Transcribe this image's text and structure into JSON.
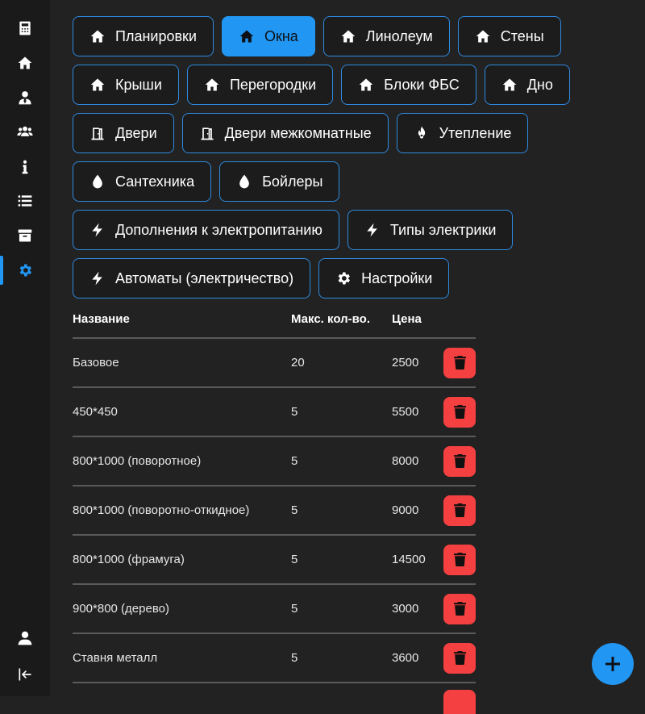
{
  "sidebar": {
    "items": [
      {
        "name": "calculator-icon"
      },
      {
        "name": "home-icon"
      },
      {
        "name": "user-tie-icon"
      },
      {
        "name": "users-icon"
      },
      {
        "name": "info-icon"
      },
      {
        "name": "list-icon"
      },
      {
        "name": "archive-icon"
      },
      {
        "name": "gear-icon",
        "active": true
      }
    ],
    "bottom": [
      {
        "name": "user-icon"
      },
      {
        "name": "sign-out-icon"
      }
    ],
    "accent": "#2196f3"
  },
  "categories": [
    {
      "label": "Планировки",
      "icon": "home-icon"
    },
    {
      "label": "Окна",
      "icon": "home-icon",
      "active": true
    },
    {
      "label": "Линолеум",
      "icon": "home-icon"
    },
    {
      "label": "Стены",
      "icon": "home-icon"
    },
    {
      "label": "Крыши",
      "icon": "home-icon"
    },
    {
      "label": "Перегородки",
      "icon": "home-icon"
    },
    {
      "label": "Блоки ФБС",
      "icon": "home-icon"
    },
    {
      "label": "Дно",
      "icon": "home-icon"
    },
    {
      "label": "Двери",
      "icon": "door-icon"
    },
    {
      "label": "Двери межкомнатные",
      "icon": "door-icon"
    },
    {
      "label": "Утепление",
      "icon": "fire-icon"
    },
    {
      "label": "Сантехника",
      "icon": "drop-icon"
    },
    {
      "label": "Бойлеры",
      "icon": "drop-icon"
    },
    {
      "label": "Дополнения к электропитанию",
      "icon": "bolt-icon"
    },
    {
      "label": "Типы электрики",
      "icon": "bolt-icon"
    },
    {
      "label": "Автоматы (электричество)",
      "icon": "bolt-icon"
    },
    {
      "label": "Настройки",
      "icon": "gear-icon"
    }
  ],
  "table": {
    "headers": {
      "name": "Название",
      "max": "Макс. кол-во.",
      "price": "Цена"
    },
    "rows": [
      {
        "name": "Базовое",
        "max": "20",
        "price": "2500"
      },
      {
        "name": "450*450",
        "max": "5",
        "price": "5500"
      },
      {
        "name": "800*1000 (поворотное)",
        "max": "5",
        "price": "8000"
      },
      {
        "name": "800*1000 (поворотно-откидное)",
        "max": "5",
        "price": "9000"
      },
      {
        "name": "800*1000 (фрамуга)",
        "max": "5",
        "price": "14500"
      },
      {
        "name": "900*800 (дерево)",
        "max": "5",
        "price": "3000"
      },
      {
        "name": "Ставня металл",
        "max": "5",
        "price": "3600"
      }
    ],
    "delete_color": "#f44040"
  },
  "fab": {
    "icon": "plus-icon"
  }
}
